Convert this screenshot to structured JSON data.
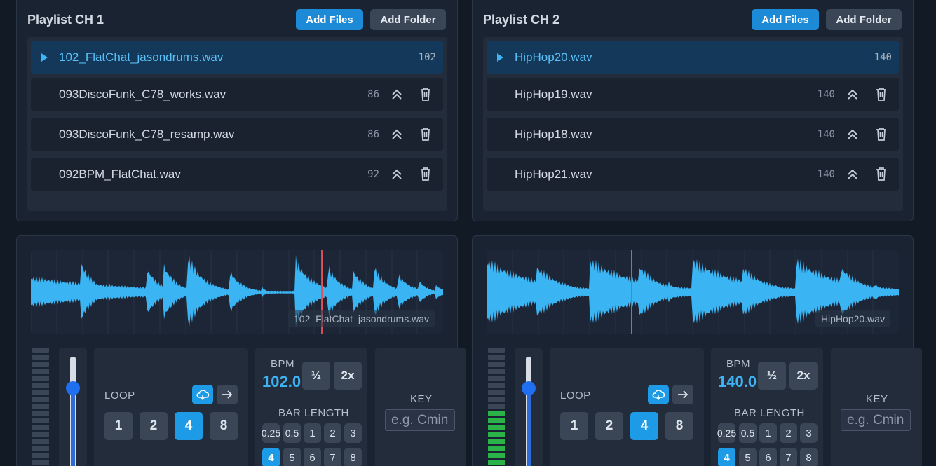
{
  "playlists": [
    {
      "title": "Playlist CH 1",
      "add_files": "Add Files",
      "add_folder": "Add Folder",
      "tracks": [
        {
          "name": "102_FlatChat_jasondrums.wav",
          "bpm": "102",
          "active": true
        },
        {
          "name": "093DiscoFunk_C78_works.wav",
          "bpm": "86",
          "active": false
        },
        {
          "name": "093DiscoFunk_C78_resamp.wav",
          "bpm": "86",
          "active": false
        },
        {
          "name": "092BPM_FlatChat.wav",
          "bpm": "92",
          "active": false
        }
      ]
    },
    {
      "title": "Playlist CH 2",
      "add_files": "Add Files",
      "add_folder": "Add Folder",
      "tracks": [
        {
          "name": "HipHop20.wav",
          "bpm": "140",
          "active": true
        },
        {
          "name": "HipHop19.wav",
          "bpm": "140",
          "active": false
        },
        {
          "name": "HipHop18.wav",
          "bpm": "140",
          "active": false
        },
        {
          "name": "HipHop21.wav",
          "bpm": "140",
          "active": false
        }
      ]
    }
  ],
  "decks": [
    {
      "filename": "102_FlatChat_jasondrums.wav",
      "playhead": 0.706,
      "level": 0.06,
      "fader": 0.72,
      "loop_label": "LOOP",
      "loop_options": [
        "1",
        "2",
        "4",
        "8"
      ],
      "loop_selected": "4",
      "bpm_label": "BPM",
      "bpm_value": "102.0",
      "half_label": "½",
      "double_label": "2x",
      "bar_length_label": "BAR LENGTH",
      "bar_options": [
        "0.25",
        "0.5",
        "1",
        "2",
        "3",
        "4",
        "5",
        "6",
        "7",
        "8"
      ],
      "bar_selected": "4",
      "key_label": "KEY",
      "key_placeholder": "e.g. Cmin"
    },
    {
      "filename": "HipHop20.wav",
      "playhead": 0.352,
      "level": 0.5,
      "fader": 0.72,
      "loop_label": "LOOP",
      "loop_options": [
        "1",
        "2",
        "4",
        "8"
      ],
      "loop_selected": "4",
      "bpm_label": "BPM",
      "bpm_value": "140.0",
      "half_label": "½",
      "double_label": "2x",
      "bar_length_label": "BAR LENGTH",
      "bar_options": [
        "0.25",
        "0.5",
        "1",
        "2",
        "3",
        "4",
        "5",
        "6",
        "7",
        "8"
      ],
      "bar_selected": "4",
      "key_label": "KEY",
      "key_placeholder": "e.g. Cmin"
    }
  ],
  "colors": {
    "accent": "#1d9be6",
    "waveform": "#3ab4f2",
    "playhead": "#e0525a",
    "meter_on": "#2bb34a"
  }
}
